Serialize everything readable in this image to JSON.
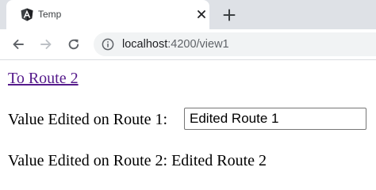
{
  "browser": {
    "tab": {
      "title": "Temp",
      "favicon_icon": "angular-logo-icon",
      "close_icon": "close-icon"
    },
    "new_tab_icon": "plus-icon",
    "toolbar": {
      "back_icon": "arrow-left-icon",
      "forward_icon": "arrow-right-icon",
      "reload_icon": "reload-icon",
      "site_info_icon": "info-circle-icon",
      "url_host": "localhost",
      "url_rest": ":4200/view1"
    },
    "colors": {
      "tabstrip_bg": "#dee1e6",
      "omnibox_bg": "#f1f3f4",
      "angular_red": "#dd0031",
      "visited_link": "#551a8b"
    }
  },
  "page": {
    "link_text": "To Route 2",
    "route1_label": "Value Edited on Route 1:",
    "route1_value": "Edited Route 1",
    "route2_label": "Value Edited on Route 2:",
    "route2_value": "Edited Route 2"
  }
}
